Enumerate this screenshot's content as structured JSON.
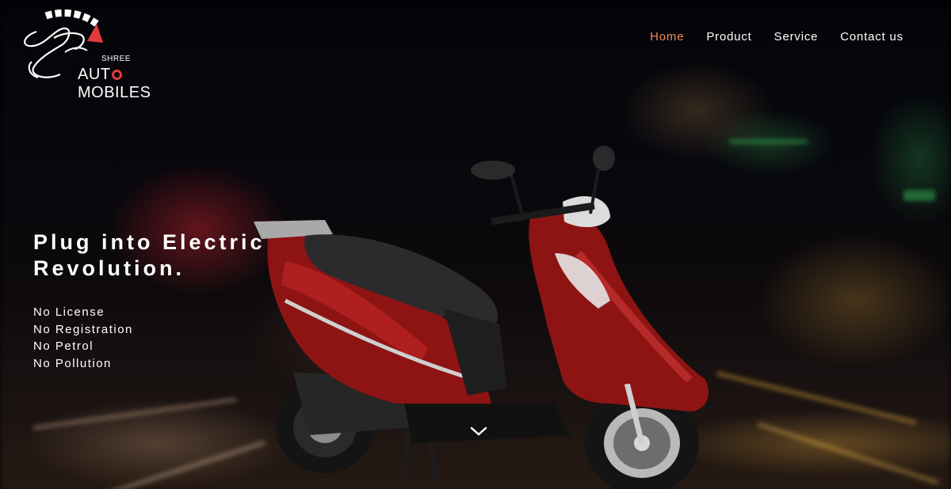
{
  "brand": {
    "shree": "SHREE",
    "automobiles_prefix": "AUT",
    "automobiles_suffix": "MOBILES"
  },
  "nav": {
    "items": [
      {
        "label": "Home",
        "active": true
      },
      {
        "label": "Product",
        "active": false
      },
      {
        "label": "Service",
        "active": false
      },
      {
        "label": "Contact us",
        "active": false
      }
    ],
    "active_color": "#f28b5a"
  },
  "hero": {
    "headline_line1": "Plug into Electric",
    "headline_line2": "Revolution.",
    "features": [
      "No License",
      "No Registration",
      "No Petrol",
      "No Pollution"
    ],
    "scroll_icon": "chevron-down-icon",
    "product_image": "red-electric-scooter"
  },
  "colors": {
    "brand_red": "#e23b3b",
    "scooter_red": "#8e1414"
  }
}
